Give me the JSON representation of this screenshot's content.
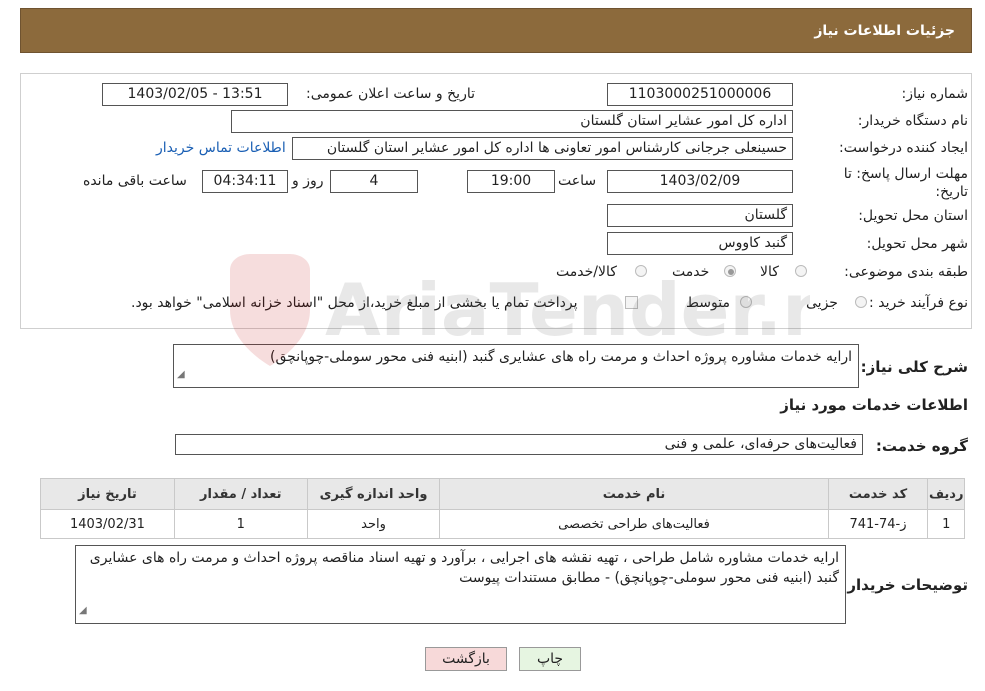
{
  "header": {
    "title": "جزئیات اطلاعات نیاز"
  },
  "fields": {
    "need_number_label": "شماره نیاز:",
    "need_number": "1103000251000006",
    "announce_label": "تاریخ و ساعت اعلان عمومی:",
    "announce_value": "1403/02/05 - 13:51",
    "buyer_org_label": "نام دستگاه خریدار:",
    "buyer_org": "اداره کل امور عشایر استان گلستان",
    "requester_label": "ایجاد کننده درخواست:",
    "requester": "حسینعلی جرجانی کارشناس امور تعاونی ها اداره کل امور عشایر استان گلستان",
    "contact_link": "اطلاعات تماس خریدار",
    "deadline_label": "مهلت ارسال پاسخ: تا تاریخ:",
    "deadline_date": "1403/02/09",
    "time_label": "ساعت",
    "deadline_time": "19:00",
    "days_value": "4",
    "days_label": "روز و",
    "remaining_time": "04:34:11",
    "remaining_label": "ساعت باقی مانده",
    "province_label": "استان محل تحویل:",
    "province": "گلستان",
    "city_label": "شهر محل تحویل:",
    "city": "گنبد کاووس",
    "category_label": "طبقه بندی موضوعی:",
    "category_options": [
      "کالا",
      "خدمت",
      "کالا/خدمت"
    ],
    "category_selected": "خدمت",
    "process_label": "نوع فرآیند خرید :",
    "process_options": [
      "جزیی",
      "متوسط"
    ],
    "payment_note": "پرداخت تمام یا بخشی از مبلغ خرید،از محل \"اسناد خزانه اسلامی\" خواهد بود."
  },
  "summary": {
    "label": "شرح کلی نیاز:",
    "text": "ارایه خدمات مشاوره پروژه احداث و مرمت راه های عشایری گنبد (ابنیه فنی محور سوملی-چوپانچق)"
  },
  "services": {
    "section_title": "اطلاعات خدمات مورد نیاز",
    "group_label": "گروه خدمت:",
    "group_value": "فعالیت‌های حرفه‌ای، علمی و فنی",
    "columns": [
      "ردیف",
      "کد خدمت",
      "نام خدمت",
      "واحد اندازه گیری",
      "تعداد / مقدار",
      "تاریخ نیاز"
    ],
    "rows": [
      [
        "1",
        "ز-74-741",
        "فعالیت‌های طراحی تخصصی",
        "واحد",
        "1",
        "1403/02/31"
      ]
    ]
  },
  "buyer_notes": {
    "label": "توضیحات خریدار:",
    "text": "ارایه خدمات مشاوره شامل طراحی ، تهیه نقشه های اجرایی ، برآورد و تهیه اسناد مناقصه پروژه احداث و مرمت راه های عشایری گنبد (ابنیه فنی محور سوملی-چوپانچق) - مطابق مستندات پیوست"
  },
  "buttons": {
    "print": "چاپ",
    "back": "بازگشت"
  },
  "watermark": {
    "text": "AriaTender.net"
  },
  "colors": {
    "header_bg": "#8c6a3c",
    "link": "#1a5fb4",
    "back_bg": "#f7d9d9",
    "print_bg": "#e6f5e1"
  }
}
